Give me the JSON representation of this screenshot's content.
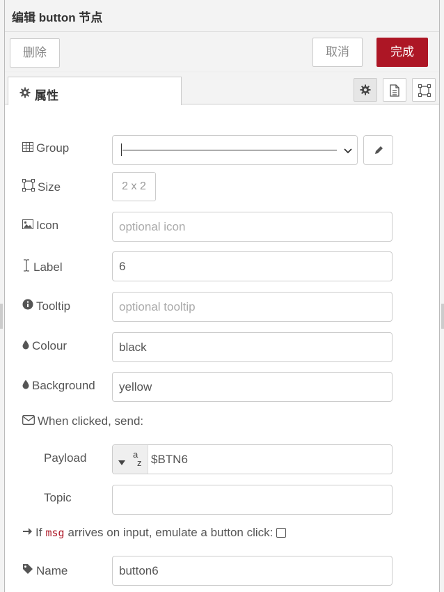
{
  "header": {
    "title": "编辑 button 节点"
  },
  "toolbar": {
    "delete_label": "删除",
    "cancel_label": "取消",
    "done_label": "完成"
  },
  "tabs": {
    "properties_label": "属性"
  },
  "tab_buttons": [
    {
      "icon": "gear-icon",
      "active": true
    },
    {
      "icon": "document-icon",
      "active": false
    },
    {
      "icon": "frame-icon",
      "active": false
    }
  ],
  "form": {
    "group": {
      "label": "Group",
      "value": "[————————————————"
    },
    "size": {
      "label": "Size",
      "value": "2 x 2"
    },
    "icon": {
      "label": "Icon",
      "value": "",
      "placeholder": "optional icon"
    },
    "label_field": {
      "label": "Label",
      "value": "6"
    },
    "tooltip": {
      "label": "Tooltip",
      "value": "",
      "placeholder": "optional tooltip"
    },
    "colour": {
      "label": "Colour",
      "value": "black"
    },
    "background": {
      "label": "Background",
      "value": "yellow"
    },
    "when_clicked": {
      "label": "When clicked, send:"
    },
    "payload": {
      "label": "Payload",
      "type_glyph_top": "a",
      "type_glyph_bottom": "z",
      "value": "$BTN6"
    },
    "topic": {
      "label": "Topic",
      "value": ""
    },
    "passthru": {
      "prefix": "If",
      "keyword": "msg",
      "suffix": "arrives on input, emulate a button click:",
      "checked": false
    },
    "name": {
      "label": "Name",
      "value": "button6"
    }
  },
  "colors": {
    "accent": "#ad1625",
    "border": "#cccccc",
    "text": "#555555"
  }
}
